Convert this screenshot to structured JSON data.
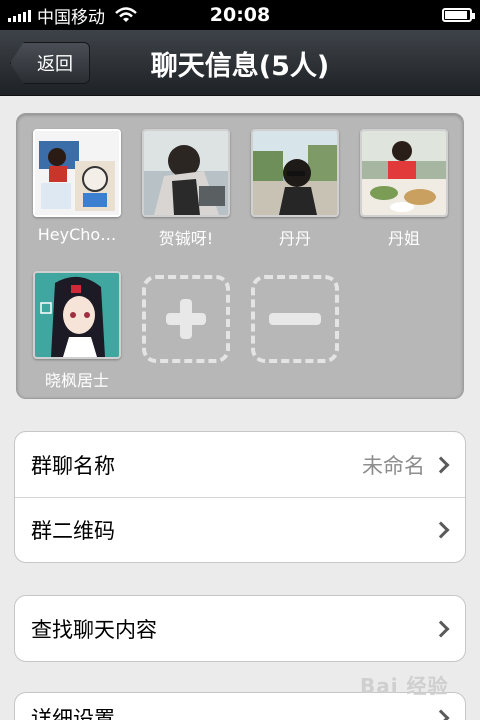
{
  "status_bar": {
    "carrier": "中国移动",
    "time": "20:08"
  },
  "nav": {
    "back_label": "返回",
    "title": "聊天信息(5人)"
  },
  "members": [
    {
      "name": "HeyCho…",
      "avatar": "avatar-heychou"
    },
    {
      "name": "贺铖呀!",
      "avatar": "avatar-hechengya"
    },
    {
      "name": "丹丹",
      "avatar": "avatar-dandan"
    },
    {
      "name": "丹姐",
      "avatar": "avatar-danjie"
    },
    {
      "name": "晓枫居士",
      "avatar": "avatar-xiaofeng"
    }
  ],
  "member_actions": {
    "add_icon": "plus-icon",
    "remove_icon": "minus-icon"
  },
  "settings": {
    "group_name_label": "群聊名称",
    "group_name_value": "未命名",
    "qr_label": "群二维码",
    "search_label": "查找聊天内容",
    "detail_label": "详细设置"
  },
  "watermark": "Bai 经验"
}
